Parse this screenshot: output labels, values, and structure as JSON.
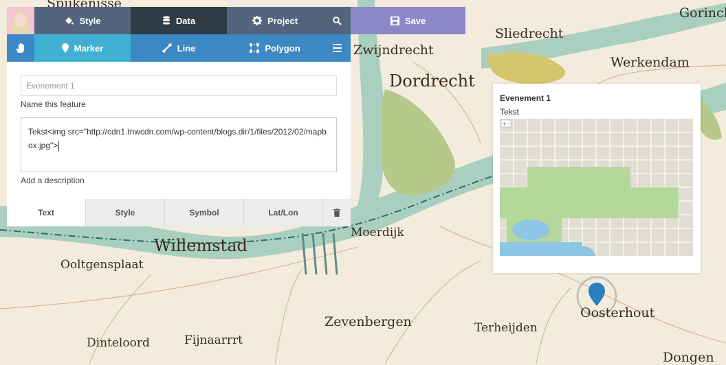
{
  "toolbar": {
    "style_label": "Style",
    "data_label": "Data",
    "project_label": "Project",
    "save_label": "Save",
    "marker_label": "Marker",
    "line_label": "Line",
    "polygon_label": "Polygon"
  },
  "map": {
    "places": [
      "Spijkenisse",
      "Sliedrecht",
      "Gorinche",
      "Zwijndrecht",
      "Dordrecht",
      "Werkendam",
      "Moerdijk",
      "Willemstad",
      "Ooltgensplaat",
      "Zevenbergen",
      "Terheijden",
      "Oosterhout",
      "Dinteloord",
      "Fijnaarrrt",
      "Dongen"
    ],
    "marker_color": "#2a81c1"
  },
  "editor": {
    "name_placeholder": "Evenement 1",
    "name_hint": "Name this feature",
    "description_value": "Tekst<img src=\"http://cdn1.tnwcdn.com/wp-content/blogs.dir/1/files/2012/02/mapbox.jpg\">",
    "description_hint": "Add a description",
    "tabs": [
      "Text",
      "Style",
      "Symbol",
      "Lat/Lon"
    ]
  },
  "popup": {
    "title": "Evenement 1",
    "description": "Tekst"
  },
  "colors": {
    "style_bg": "#52657d",
    "data_bg": "#2f3b45",
    "save_bg": "#8c87c9",
    "marker_bg": "#3fb0d2",
    "draw_bg": "#3c88c4"
  }
}
